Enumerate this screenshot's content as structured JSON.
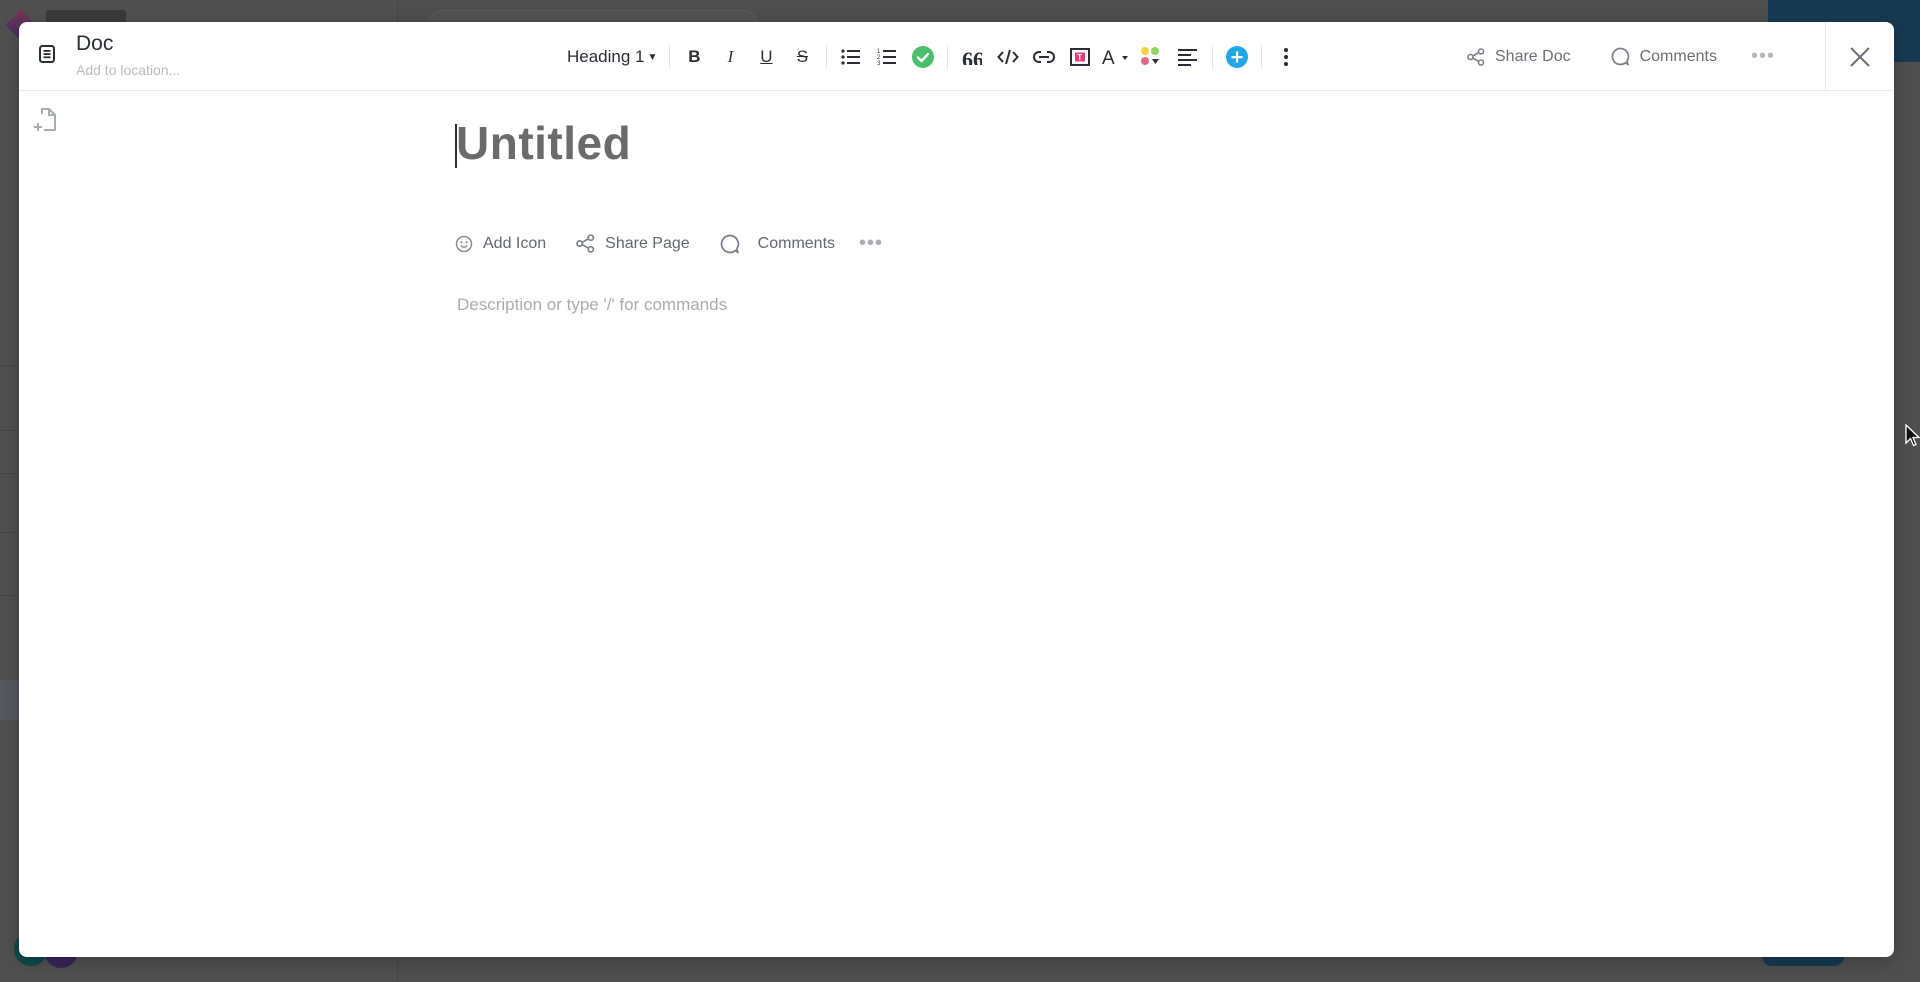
{
  "doc": {
    "type_label": "Doc",
    "location_placeholder": "Add to location..."
  },
  "toolbar": {
    "heading_label": "Heading 1",
    "bold": "B",
    "italic": "I",
    "underline": "U",
    "strikethrough": "S",
    "items": [
      "bulleted-list",
      "numbered-list",
      "checklist",
      "quote",
      "code",
      "link",
      "text-highlight",
      "text-color",
      "color-palette",
      "align-left",
      "insert",
      "more-options"
    ]
  },
  "header_actions": {
    "share_doc": "Share Doc",
    "comments": "Comments",
    "more": "•••"
  },
  "page": {
    "title": "Untitled",
    "add_icon": "Add Icon",
    "share_page": "Share Page",
    "comments": "Comments",
    "more": "•••",
    "description_placeholder": "Description or type '/' for commands"
  },
  "colors": {
    "checklist_green": "#4bbf6b",
    "insert_blue": "#23a6e8",
    "highlight_pink": "#e53e7f",
    "palette": [
      "#f3d33a",
      "#8fd36a",
      "#e36a80"
    ]
  }
}
